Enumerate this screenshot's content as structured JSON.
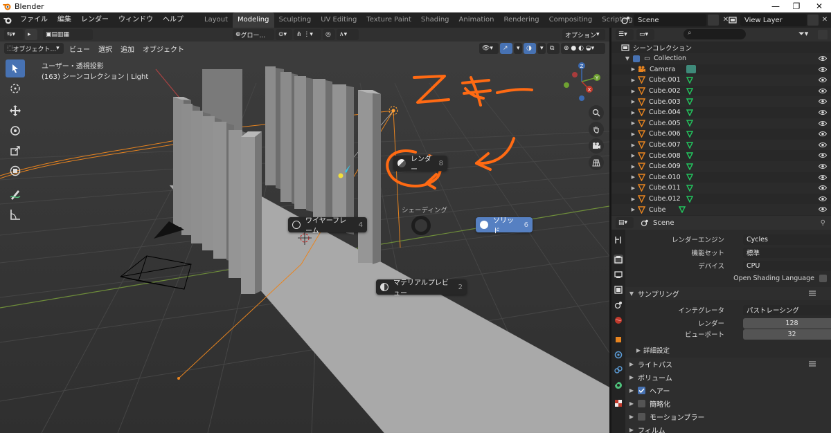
{
  "window": {
    "title": "Blender"
  },
  "menu": [
    "ファイル",
    "編集",
    "レンダー",
    "ウィンドウ",
    "ヘルプ"
  ],
  "workspaces": [
    "Layout",
    "Modeling",
    "Sculpting",
    "UV Editing",
    "Texture Paint",
    "Shading",
    "Animation",
    "Rendering",
    "Compositing",
    "Scripting"
  ],
  "scene": {
    "name": "Scene",
    "view_layer": "View Layer"
  },
  "viewport": {
    "transform": "グロー...",
    "options": "オプション",
    "mode": "オブジェクト...",
    "menu": [
      "ビュー",
      "選択",
      "追加",
      "オブジェクト"
    ],
    "view_name": "ユーザー・透視投影",
    "view_info": "(163) シーンコレクション | Light"
  },
  "pie": {
    "title": "シェーディング",
    "items": [
      {
        "label": "レンダー",
        "key": "8"
      },
      {
        "label": "ワイヤーフレーム",
        "key": "4"
      },
      {
        "label": "ソリッド",
        "key": "6"
      },
      {
        "label": "マテリアルプレビュー",
        "key": "2"
      }
    ]
  },
  "annotation": {
    "text": "Zキー",
    "color": "#ff6a13"
  },
  "outliner": {
    "root": "シーンコレクション",
    "collection": "Collection",
    "items": [
      "Camera",
      "Cube.001",
      "Cube.002",
      "Cube.003",
      "Cube.004",
      "Cube.005",
      "Cube.006",
      "Cube.007",
      "Cube.008",
      "Cube.009",
      "Cube.010",
      "Cube.011",
      "Cube.012",
      "Cube"
    ]
  },
  "properties": {
    "context": "Scene",
    "render_engine": {
      "label": "レンダーエンジン",
      "value": "Cycles"
    },
    "feature_set": {
      "label": "機能セット",
      "value": "標準"
    },
    "device": {
      "label": "デバイス",
      "value": "CPU"
    },
    "osl": {
      "label": "Open Shading Language",
      "checked": false
    },
    "sampling": {
      "title": "サンプリング",
      "integrator": {
        "label": "インテグレータ",
        "value": "パストレーシング"
      },
      "render": {
        "label": "レンダー",
        "value": "128"
      },
      "viewport": {
        "label": "ビューポート",
        "value": "32"
      },
      "advanced": "詳細設定"
    },
    "panels": [
      {
        "label": "ライトパス",
        "checkbox": null
      },
      {
        "label": "ボリューム",
        "checkbox": null
      },
      {
        "label": "ヘアー",
        "checkbox": true
      },
      {
        "label": "簡略化",
        "checkbox": false
      },
      {
        "label": "モーションブラー",
        "checkbox": false
      },
      {
        "label": "フィルム",
        "checkbox": null
      }
    ]
  },
  "colors": {
    "accent": "#4772b3",
    "pie_active": "#5680c2",
    "selection": "#ffa033",
    "mesh_icon": "#22c55e"
  }
}
